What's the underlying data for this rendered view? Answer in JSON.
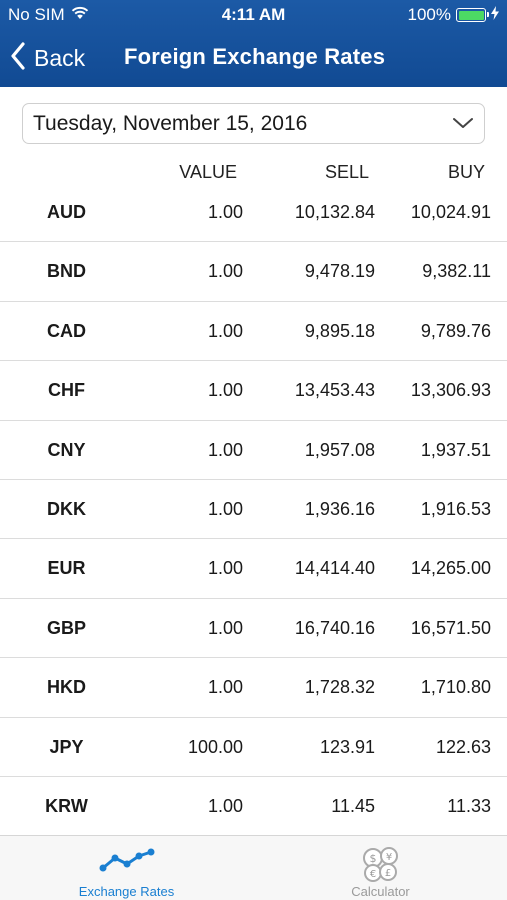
{
  "status_bar": {
    "carrier": "No SIM",
    "time": "4:11 AM",
    "battery": "100%",
    "battery_level": 1.0
  },
  "nav": {
    "back_label": "Back",
    "title": "Foreign Exchange Rates"
  },
  "date_selector": {
    "selected": "Tuesday, November 15, 2016"
  },
  "table": {
    "headers": {
      "value": "VALUE",
      "sell": "SELL",
      "buy": "BUY"
    },
    "rows": [
      {
        "code": "AUD",
        "value": "1.00",
        "sell": "10,132.84",
        "buy": "10,024.91"
      },
      {
        "code": "BND",
        "value": "1.00",
        "sell": "9,478.19",
        "buy": "9,382.11"
      },
      {
        "code": "CAD",
        "value": "1.00",
        "sell": "9,895.18",
        "buy": "9,789.76"
      },
      {
        "code": "CHF",
        "value": "1.00",
        "sell": "13,453.43",
        "buy": "13,306.93"
      },
      {
        "code": "CNY",
        "value": "1.00",
        "sell": "1,957.08",
        "buy": "1,937.51"
      },
      {
        "code": "DKK",
        "value": "1.00",
        "sell": "1,936.16",
        "buy": "1,916.53"
      },
      {
        "code": "EUR",
        "value": "1.00",
        "sell": "14,414.40",
        "buy": "14,265.00"
      },
      {
        "code": "GBP",
        "value": "1.00",
        "sell": "16,740.16",
        "buy": "16,571.50"
      },
      {
        "code": "HKD",
        "value": "1.00",
        "sell": "1,728.32",
        "buy": "1,710.80"
      },
      {
        "code": "JPY",
        "value": "100.00",
        "sell": "123.91",
        "buy": "122.63"
      },
      {
        "code": "KRW",
        "value": "1.00",
        "sell": "11.45",
        "buy": "11.33"
      }
    ]
  },
  "tab_bar": {
    "tabs": [
      {
        "label": "Exchange Rates",
        "icon": "line-chart-icon",
        "active": true
      },
      {
        "label": "Calculator",
        "icon": "currency-coins-icon",
        "active": false
      }
    ]
  },
  "colors": {
    "header": "#1c5aa6",
    "active_tab": "#1a7fd1",
    "inactive_tab": "#9a9a9a",
    "battery": "#4cd964"
  }
}
